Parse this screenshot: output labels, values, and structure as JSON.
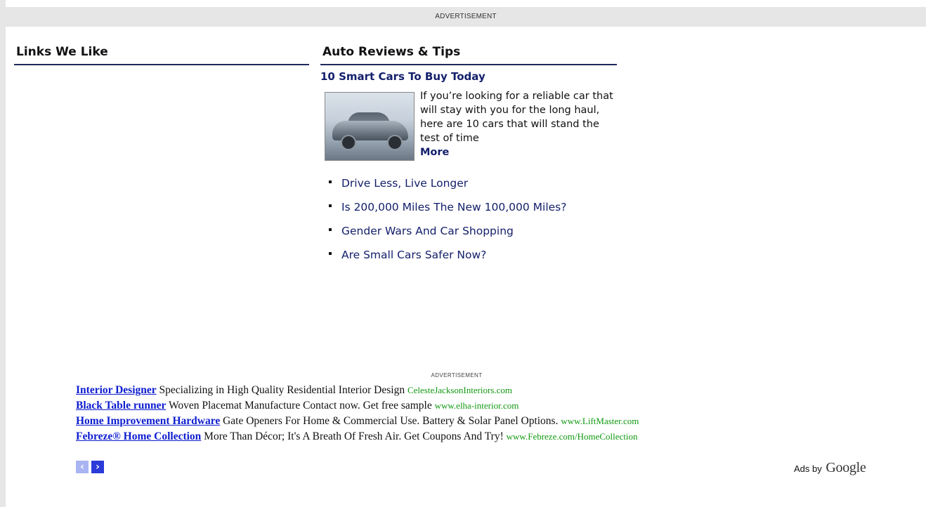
{
  "top_ad": {
    "label": "ADVERTISEMENT"
  },
  "links_we_like": {
    "title": "Links We Like"
  },
  "auto_reviews": {
    "title": "Auto Reviews & Tips",
    "feature": {
      "title": "10 Smart Cars To Buy Today",
      "description": "If you’re looking for a reliable car that will stay with you for the long haul, here are 10 cars that will stand the test of time",
      "more_label": "More"
    },
    "links": [
      {
        "label": "Drive Less, Live Longer"
      },
      {
        "label": "Is 200,000 Miles The New 100,000 Miles?"
      },
      {
        "label": "Gender Wars And Car Shopping"
      },
      {
        "label": "Are Small Cars Safer Now?"
      }
    ]
  },
  "google_ads": {
    "label": "ADVERTISEMENT",
    "ads": [
      {
        "title": "Interior Designer",
        "text": "Specializing in High Quality Residential Interior Design",
        "url": "CelesteJacksonInteriors.com"
      },
      {
        "title": "Black Table runner",
        "text": "Woven Placemat Manufacture Contact now. Get free sample",
        "url": "www.elha-interior.com"
      },
      {
        "title": "Home Improvement Hardware",
        "text": "Gate Openers For Home & Commercial Use. Battery & Solar Panel Options.",
        "url": "www.LiftMaster.com"
      },
      {
        "title": "Febreze® Home Collection",
        "text": "More Than Décor; It's A Breath Of Fresh Air. Get Coupons And Try!",
        "url": "www.Febreze.com/HomeCollection"
      }
    ],
    "prev_glyph": "‹",
    "next_glyph": "›",
    "ads_by": "Ads by",
    "google": "Google"
  },
  "colors": {
    "link": "#14206b",
    "ad_title": "#0d1ccf",
    "ad_url": "#119911",
    "band": "#e6e6e6"
  }
}
